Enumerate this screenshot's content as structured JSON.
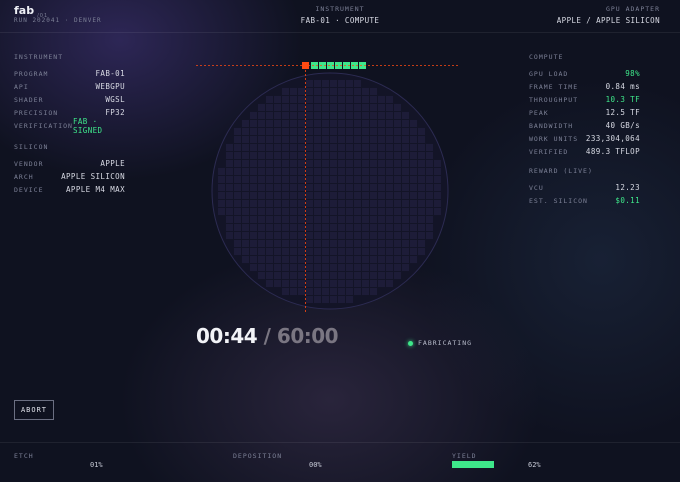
{
  "header": {
    "logo": "fab",
    "logo_sub": "01",
    "run": "RUN 202041 · DENVER",
    "instrument_label": "INSTRUMENT",
    "instrument_value": "FAB-01 · COMPUTE",
    "adapter_label": "GPU ADAPTER",
    "adapter_value": "APPLE / APPLE SILICON"
  },
  "left": {
    "instrument_title": "INSTRUMENT",
    "instrument_rows": [
      {
        "label": "PROGRAM",
        "value": "FAB-01"
      },
      {
        "label": "API",
        "value": "WEBGPU"
      },
      {
        "label": "SHADER",
        "value": "WGSL"
      },
      {
        "label": "PRECISION",
        "value": "FP32"
      },
      {
        "label": "VERIFICATION",
        "value": "FAB · SIGNED"
      }
    ],
    "silicon_title": "SILICON",
    "silicon_rows": [
      {
        "label": "VENDOR",
        "value": "APPLE"
      },
      {
        "label": "ARCH",
        "value": "APPLE SILICON"
      },
      {
        "label": "DEVICE",
        "value": "APPLE M4 MAX"
      }
    ]
  },
  "right": {
    "compute_title": "COMPUTE",
    "compute_rows": [
      {
        "label": "GPU LOAD",
        "value": "98%"
      },
      {
        "label": "FRAME TIME",
        "value": "0.84 ms"
      },
      {
        "label": "THROUGHPUT",
        "value": "10.3 TF"
      },
      {
        "label": "PEAK",
        "value": "12.5 TF"
      },
      {
        "label": "BANDWIDTH",
        "value": "40 GB/s"
      },
      {
        "label": "WORK UNITS",
        "value": "233,304,064"
      },
      {
        "label": "VERIFIED",
        "value": "489.3 TFLOP"
      }
    ],
    "reward_title": "REWARD (LIVE)",
    "reward_rows": [
      {
        "label": "VCU",
        "value": "12.23"
      },
      {
        "label": "EST. SILICON",
        "value": "$0.11"
      }
    ]
  },
  "wafer": {
    "cells_done": 7,
    "colors": {
      "active": "#ff4a12",
      "done": "#3ee78a",
      "cell": "#1d1c38",
      "disc": "#131427"
    }
  },
  "timer": {
    "elapsed": "00:44",
    "separator": "/",
    "total": "60:00"
  },
  "status": {
    "label": "FABRICATING",
    "color": "#3ee78a"
  },
  "abort_label": "ABORT",
  "bottom": {
    "etch_label": "ETCH",
    "etch_value": "01%",
    "deposition_label": "DEPOSITION",
    "deposition_value": "00%",
    "yield_label": "YIELD",
    "yield_value": "62%"
  }
}
